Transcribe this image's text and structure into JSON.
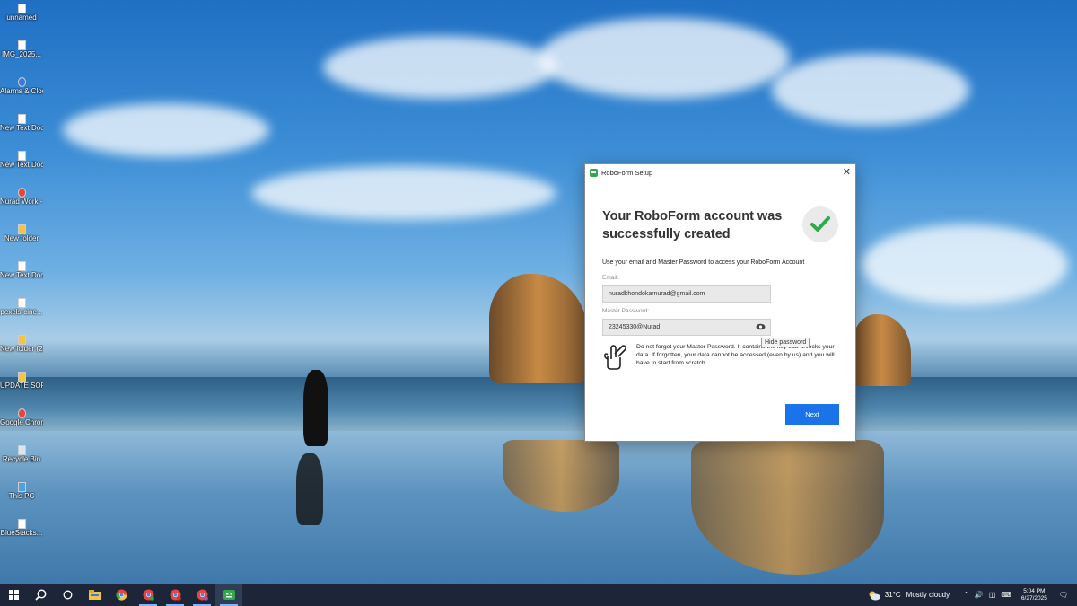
{
  "desktop": {
    "icons": [
      {
        "label": "unnamed",
        "icon": "file-icon"
      },
      {
        "label": "IMG_2025...",
        "icon": "image-file-icon"
      },
      {
        "label": "Alarms & Clock",
        "icon": "alarm-icon"
      },
      {
        "label": "New Text Docume...",
        "icon": "text-file-icon"
      },
      {
        "label": "New Text Document",
        "icon": "text-file-icon"
      },
      {
        "label": "Nurad Work - Chrome",
        "icon": "chrome-icon"
      },
      {
        "label": "New folder",
        "icon": "folder-icon"
      },
      {
        "label": "New Text Docume...",
        "icon": "text-file-icon"
      },
      {
        "label": "pexels-cine...",
        "icon": "file-icon"
      },
      {
        "label": "New folder (2)",
        "icon": "folder-icon"
      },
      {
        "label": "UPDATE SOFT",
        "icon": "folder-icon"
      },
      {
        "label": "Google Chrome",
        "icon": "chrome-icon"
      },
      {
        "label": "Recycle Bin",
        "icon": "recycle-bin-icon"
      },
      {
        "label": "This PC",
        "icon": "computer-icon"
      },
      {
        "label": "BlueStacks...",
        "icon": "file-icon"
      }
    ]
  },
  "dialog": {
    "title": "RoboForm Setup",
    "close": "✕",
    "headline": "Your RoboForm account was successfully created",
    "intro": "Use your email and Master Password to access your RoboForm Account",
    "email_label": "Email:",
    "email_value": "nuradkhondokarnurad@gmail.com",
    "password_label": "Master Password:",
    "password_value": "23245330@Nurad",
    "tooltip": "Hide password",
    "warning": "Do not forget your Master Password. It contains the key that unlocks your data. If forgotten, your data cannot be accessed (even by us) and you will have to start from scratch.",
    "next_label": "Next",
    "accent_color": "#1a73e8",
    "success_color": "#2fa84f"
  },
  "taskbar": {
    "weather_temp": "31°C",
    "weather_text": "Mostly cloudy",
    "time": "5:04 PM",
    "date": "6/27/2025",
    "items": [
      "windows-start-icon",
      "search-icon",
      "cortana-icon",
      "file-explorer-icon",
      "chrome-icon",
      "chrome-profile-1-icon",
      "chrome-profile-2-icon",
      "chrome-profile-3-icon",
      "roboform-icon"
    ]
  }
}
